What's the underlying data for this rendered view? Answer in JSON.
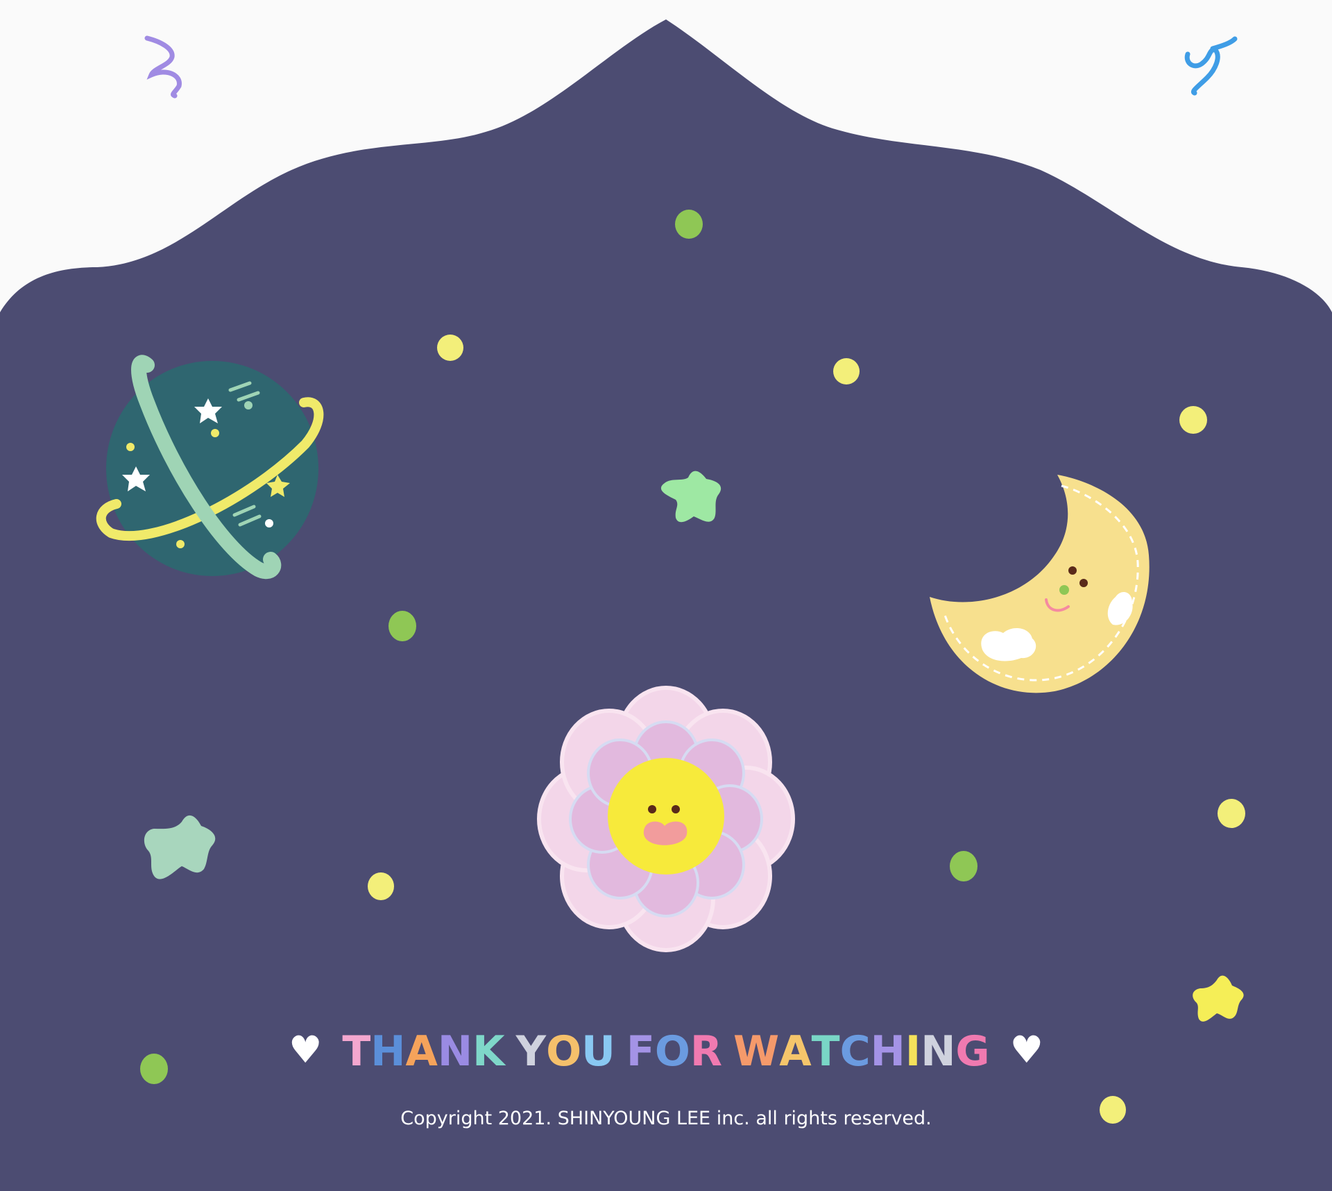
{
  "footer": {
    "heart_left": "♥",
    "heart_right": "♥",
    "title_words": [
      "THANK",
      "YOU",
      "FOR",
      "WATCHING"
    ],
    "title_letter_colors": [
      [
        "#f4a7cf",
        "#5b8fd9",
        "#f5a35b",
        "#9a8be3",
        "#7fd7c9"
      ],
      [
        "#cfd2de",
        "#f5c06b",
        "#89c8f2"
      ],
      [
        "#a493e6",
        "#6b9be0",
        "#f07ab0"
      ],
      [
        "#f59a6b",
        "#f5c56b",
        "#79d6c6",
        "#6b9be0",
        "#a493e6",
        "#f5e25b",
        "#cfd2de",
        "#f07ab0"
      ]
    ],
    "copyright": "Copyright 2021. SHINYOUNG LEE inc. all rights reserved."
  },
  "colors": {
    "background": "#fafafa",
    "sky": "#4c4c72",
    "planet": "#2f6670",
    "ring_yellow": "#f0ea6a",
    "ring_mint": "#9fd4b5",
    "moon": "#f7e08e",
    "flower_outer": "#f3d6e9",
    "flower_inner": "#e2b9de",
    "flower_face": "#f7ea3b",
    "dot_yellow": "#f3ef7a",
    "dot_green": "#8fc755",
    "star_green": "#9ee8a3",
    "star_mint": "#a8d6bd",
    "star_yellow": "#f5ee57"
  },
  "decorations": [
    "purple-swirl-icon",
    "blue-swirl-icon",
    "planet-icon",
    "moon-icon",
    "flower-icon",
    "star-icon",
    "dot-icon"
  ]
}
